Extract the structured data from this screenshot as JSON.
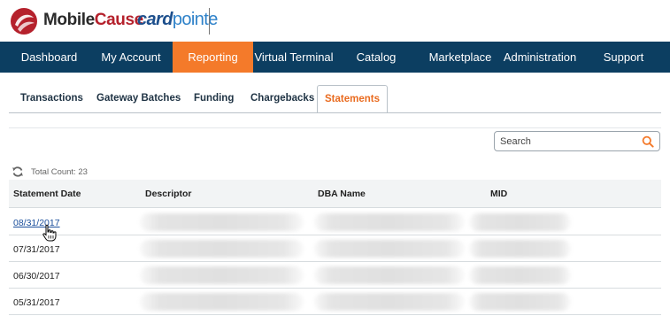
{
  "brand": {
    "mobilecause_part1": "Mobile",
    "mobilecause_part2": "Cause",
    "cardpointe_part1": "card",
    "cardpointe_part2": "pointe",
    "red": "#b5212c",
    "navy": "#1d4f8c",
    "light_blue": "#2f82c9"
  },
  "nav": {
    "items": [
      {
        "label": "Dashboard"
      },
      {
        "label": "My Account"
      },
      {
        "label": "Reporting",
        "active": true
      },
      {
        "label": "Virtual Terminal"
      },
      {
        "label": "Catalog"
      },
      {
        "label": "Marketplace"
      },
      {
        "label": "Administration"
      },
      {
        "label": "Support"
      }
    ],
    "bg_color": "#0c3e61",
    "active_color": "#f47a2a"
  },
  "subtabs": {
    "items": [
      {
        "label": "Transactions"
      },
      {
        "label": "Gateway Batches"
      },
      {
        "label": "Funding"
      },
      {
        "label": "Chargebacks"
      },
      {
        "label": "Statements",
        "active": true
      }
    ],
    "active_color": "#e96b1f"
  },
  "search": {
    "placeholder": "Search",
    "value": "",
    "icon": "search-icon",
    "icon_color": "#f47a2a"
  },
  "summary": {
    "refresh_icon": "refresh-icon",
    "total_count_text": "Total Count: 23"
  },
  "table": {
    "columns": [
      "Statement Date",
      "Descriptor",
      "DBA Name",
      "MID"
    ],
    "rows": [
      {
        "date": "08/31/2017",
        "is_link": true
      },
      {
        "date": "07/31/2017"
      },
      {
        "date": "06/30/2017"
      },
      {
        "date": "05/31/2017"
      }
    ],
    "link_color": "#1b4f9c"
  }
}
